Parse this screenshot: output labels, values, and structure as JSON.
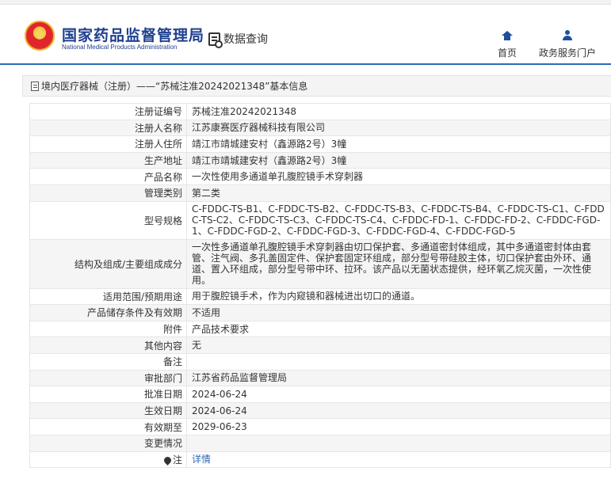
{
  "header": {
    "org_name_cn": "国家药品监督管理局",
    "org_name_en": "National Medical Products Administration",
    "data_query": "数据查询",
    "nav": [
      {
        "label": "首页",
        "icon": "home-icon"
      },
      {
        "label": "政务服务门户",
        "icon": "user-icon"
      }
    ]
  },
  "breadcrumb": "境内医疗器械（注册）——“苏械注准20242021348”基本信息",
  "rows": [
    {
      "key": "注册证编号",
      "value": "苏械注准20242021348"
    },
    {
      "key": "注册人名称",
      "value": "江苏康赛医疗器械科技有限公司"
    },
    {
      "key": "注册人住所",
      "value": "靖江市靖城建安村（鑫源路2号）3幢"
    },
    {
      "key": "生产地址",
      "value": "靖江市靖城建安村（鑫源路2号）3幢"
    },
    {
      "key": "产品名称",
      "value": "一次性使用多通道单孔腹腔镜手术穿刺器"
    },
    {
      "key": "管理类别",
      "value": "第二类"
    },
    {
      "key": "型号规格",
      "value": "C-FDDC-TS-B1、C-FDDC-TS-B2、C-FDDC-TS-B3、C-FDDC-TS-B4、C-FDDC-TS-C1、C-FDDC-TS-C2、C-FDDC-TS-C3、C-FDDC-TS-C4、C-FDDC-FD-1、C-FDDC-FD-2、C-FDDC-FGD-1、C-FDDC-FGD-2、C-FDDC-FGD-3、C-FDDC-FGD-4、C-FDDC-FGD-5"
    },
    {
      "key": "结构及组成/主要组成成分",
      "value": "一次性多通道单孔腹腔镜手术穿刺器由切口保护套、多通道密封体组成，其中多通道密封体由套管、注气阀、多孔盖固定件、保护套固定环组成，部分型号带硅胶主体，切口保护套由外环、通道、置入环组成，部分型号带中环、拉环。该产品以无菌状态提供，经环氧乙烷灭菌，一次性使用。"
    },
    {
      "key": "适用范围/预期用途",
      "value": "用于腹腔镜手术，作为内窥镜和器械进出切口的通道。"
    },
    {
      "key": "产品储存条件及有效期",
      "value": "不适用"
    },
    {
      "key": "附件",
      "value": "产品技术要求"
    },
    {
      "key": "其他内容",
      "value": "无"
    },
    {
      "key": "备注",
      "value": ""
    },
    {
      "key": "审批部门",
      "value": "江苏省药品监督管理局"
    },
    {
      "key": "批准日期",
      "value": "2024-06-24"
    },
    {
      "key": "生效日期",
      "value": "2024-06-24"
    },
    {
      "key": "有效期至",
      "value": "2029-06-23"
    },
    {
      "key": "变更情况",
      "value": ""
    },
    {
      "key": "注",
      "value": "详情",
      "link": true,
      "icon": "pin-icon"
    }
  ]
}
